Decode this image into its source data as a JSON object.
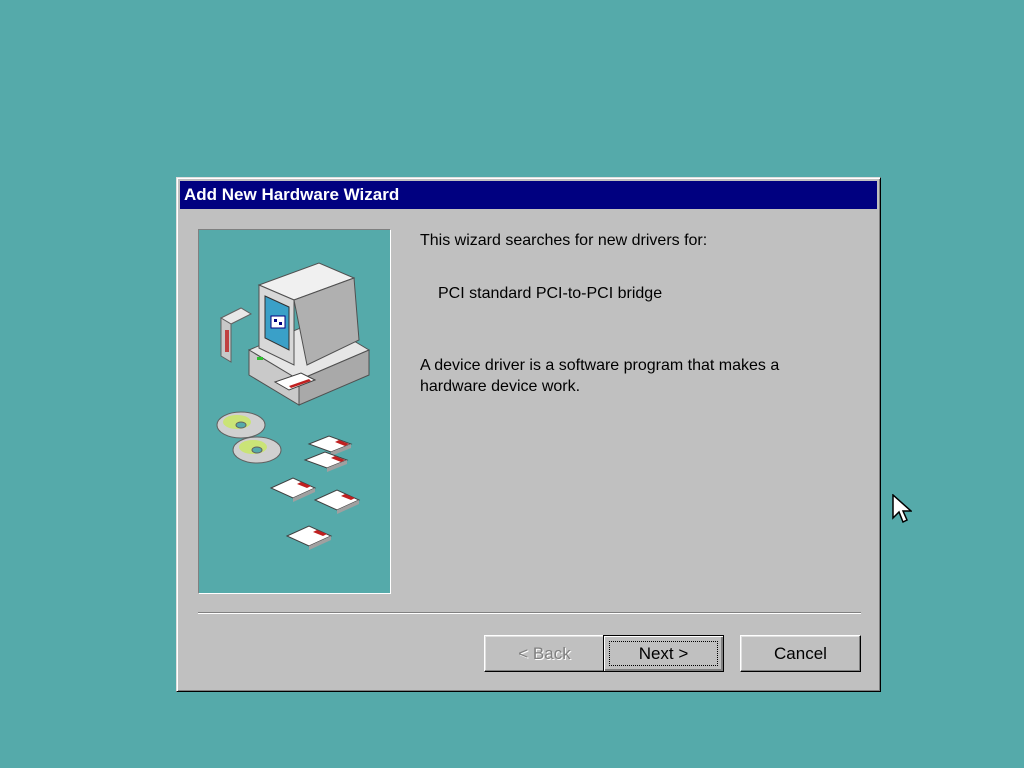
{
  "window": {
    "title": "Add New Hardware Wizard"
  },
  "content": {
    "intro": "This wizard searches for new drivers for:",
    "device_name": "PCI standard PCI-to-PCI bridge",
    "description": "A device driver is a software program that makes a hardware device work."
  },
  "buttons": {
    "back_label": "< Back",
    "next_label": "Next >",
    "cancel_label": "Cancel"
  },
  "colors": {
    "desktop": "#55aaaa",
    "titlebar": "#000080",
    "dialog": "#c0c0c0"
  },
  "icons": {
    "wizard_art": "computer-with-cds-and-floppies",
    "cursor": "arrow-cursor-icon"
  }
}
